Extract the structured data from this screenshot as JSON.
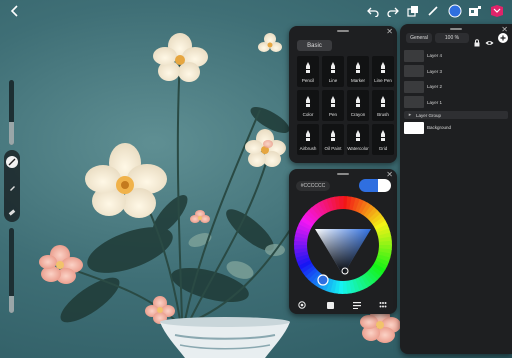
{
  "top_bar": {
    "back_icon": "chevron-left-icon",
    "tools": [
      "undo-icon",
      "redo-icon",
      "layers-icon",
      "pen-icon",
      "color-icon",
      "gallery-icon",
      "logo-icon"
    ],
    "active_color": "#2f6fe0"
  },
  "left_rail": {
    "size_level": 0.35,
    "opacity_level": 0.2,
    "tools": [
      "pencil-icon",
      "smudge-icon",
      "eraser-icon"
    ]
  },
  "brush_panel": {
    "tab_label": "Basic",
    "brushes": [
      {
        "label": "Pencil",
        "icon": "pencil-brush-icon"
      },
      {
        "label": "Line",
        "icon": "line-brush-icon"
      },
      {
        "label": "Marker",
        "icon": "marker-brush-icon"
      },
      {
        "label": "Line Pen",
        "icon": "line-pen-brush-icon"
      },
      {
        "label": "Color",
        "icon": "color-brush-icon"
      },
      {
        "label": "Pen",
        "icon": "pen-brush-icon"
      },
      {
        "label": "Crayon",
        "icon": "crayon-brush-icon"
      },
      {
        "label": "Brush",
        "icon": "brush-icon"
      },
      {
        "label": "Airbrush",
        "icon": "airbrush-icon"
      },
      {
        "label": "Oil Paint",
        "icon": "oil-paint-icon"
      },
      {
        "label": "Watercolor",
        "icon": "watercolor-icon"
      },
      {
        "label": "Grid",
        "icon": "grid-brush-icon"
      }
    ]
  },
  "color_panel": {
    "hex_value": "#CCCCCC",
    "primary_color": "#2f6fe0",
    "secondary_color": "#ffffff",
    "bottom_icons": [
      "color-history-icon",
      "square-icon",
      "sliders-icon",
      "palette-grid-icon"
    ]
  },
  "layers_panel": {
    "blend_mode": "General",
    "opacity": "100 %",
    "layers": [
      {
        "name": "Layer 4",
        "type": "layer"
      },
      {
        "name": "Layer 3",
        "type": "layer"
      },
      {
        "name": "Layer 2",
        "type": "layer"
      },
      {
        "name": "Layer 1",
        "type": "layer"
      },
      {
        "name": "Layer Group",
        "type": "group"
      },
      {
        "name": "Background",
        "type": "background"
      }
    ]
  }
}
